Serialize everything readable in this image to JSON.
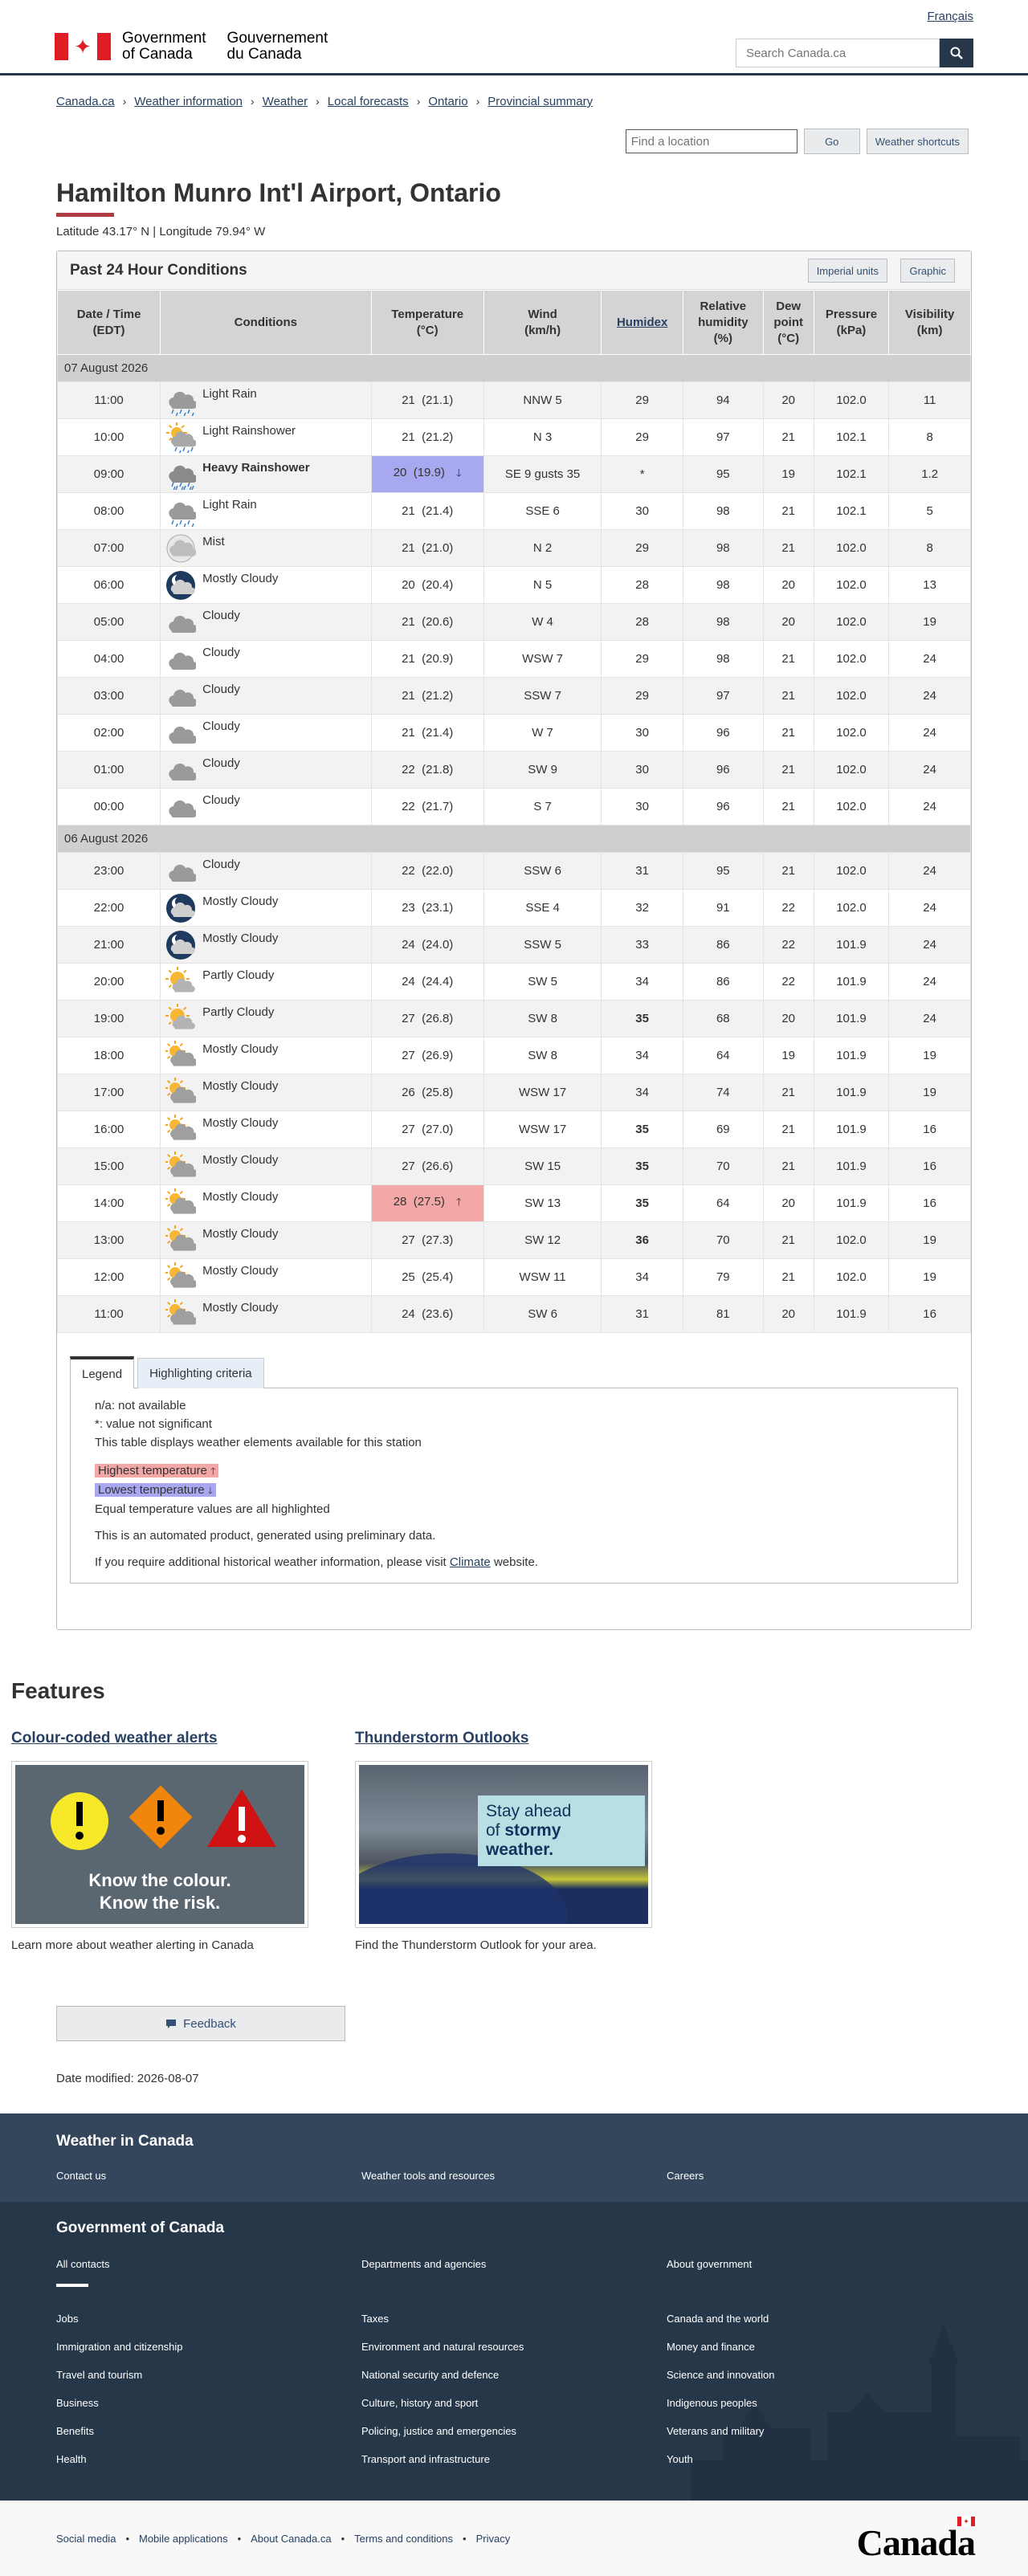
{
  "header": {
    "lang_link": "Français",
    "sig_en": [
      "Government",
      "of Canada"
    ],
    "sig_fr": [
      "Gouvernement",
      "du Canada"
    ],
    "search_placeholder": "Search Canada.ca"
  },
  "breadcrumb": [
    "Canada.ca",
    "Weather information",
    "Weather",
    "Local forecasts",
    "Ontario",
    "Provincial summary"
  ],
  "location_search": {
    "placeholder": "Find a location",
    "go_label": "Go",
    "shortcuts_label": "Weather shortcuts"
  },
  "page": {
    "title": "Hamilton Munro Int'l Airport, Ontario",
    "latlon": "Latitude 43.17° N | Longitude 79.94° W"
  },
  "panel": {
    "title": "Past 24 Hour Conditions",
    "imperial_label": "Imperial units",
    "graphic_label": "Graphic"
  },
  "table": {
    "headers": {
      "datetime": [
        "Date / Time",
        "(EDT)"
      ],
      "conditions": "Conditions",
      "temperature": [
        "Temperature",
        "(°C)"
      ],
      "wind": [
        "Wind",
        "(km/h)"
      ],
      "humidex": "Humidex",
      "humidity": [
        "Relative",
        "humidity",
        "(%)"
      ],
      "dewpoint": [
        "Dew",
        "point",
        "(°C)"
      ],
      "pressure": [
        "Pressure",
        "(kPa)"
      ],
      "visibility": [
        "Visibility",
        "(km)"
      ]
    },
    "groups": [
      {
        "date": "07 August 2026",
        "rows": [
          {
            "time": "11:00",
            "icon": "rain-icon",
            "cond": "Light Rain",
            "temp": "21",
            "temp_exact": "(21.1)",
            "wind": "NNW 5",
            "humidex": "29",
            "hum": "94",
            "dew": "20",
            "pres": "102.0",
            "vis": "11"
          },
          {
            "time": "10:00",
            "icon": "sun-rain-icon",
            "cond": "Light Rainshower",
            "temp": "21",
            "temp_exact": "(21.2)",
            "wind": "N 3",
            "humidex": "29",
            "hum": "97",
            "dew": "21",
            "pres": "102.1",
            "vis": "8"
          },
          {
            "time": "09:00",
            "icon": "heavy-rain-icon",
            "cond": "Heavy Rainshower",
            "cond_bold": true,
            "temp": "20",
            "temp_exact": "(19.9)",
            "temp_flag": "low",
            "wind": "SE 9 gusts 35",
            "humidex": "*",
            "hum": "95",
            "dew": "19",
            "pres": "102.1",
            "vis": "1.2"
          },
          {
            "time": "08:00",
            "icon": "rain-icon",
            "cond": "Light Rain",
            "temp": "21",
            "temp_exact": "(21.4)",
            "wind": "SSE 6",
            "humidex": "30",
            "hum": "98",
            "dew": "21",
            "pres": "102.1",
            "vis": "5"
          },
          {
            "time": "07:00",
            "icon": "mist-icon",
            "cond": "Mist",
            "temp": "21",
            "temp_exact": "(21.0)",
            "wind": "N 2",
            "humidex": "29",
            "hum": "98",
            "dew": "21",
            "pres": "102.0",
            "vis": "8"
          },
          {
            "time": "06:00",
            "icon": "night-cloud-icon",
            "cond": "Mostly Cloudy",
            "temp": "20",
            "temp_exact": "(20.4)",
            "wind": "N 5",
            "humidex": "28",
            "hum": "98",
            "dew": "20",
            "pres": "102.0",
            "vis": "13"
          },
          {
            "time": "05:00",
            "icon": "cloud-icon",
            "cond": "Cloudy",
            "temp": "21",
            "temp_exact": "(20.6)",
            "wind": "W 4",
            "humidex": "28",
            "hum": "98",
            "dew": "20",
            "pres": "102.0",
            "vis": "19"
          },
          {
            "time": "04:00",
            "icon": "cloud-icon",
            "cond": "Cloudy",
            "temp": "21",
            "temp_exact": "(20.9)",
            "wind": "WSW 7",
            "humidex": "29",
            "hum": "98",
            "dew": "21",
            "pres": "102.0",
            "vis": "24"
          },
          {
            "time": "03:00",
            "icon": "cloud-icon",
            "cond": "Cloudy",
            "temp": "21",
            "temp_exact": "(21.2)",
            "wind": "SSW 7",
            "humidex": "29",
            "hum": "97",
            "dew": "21",
            "pres": "102.0",
            "vis": "24"
          },
          {
            "time": "02:00",
            "icon": "cloud-icon",
            "cond": "Cloudy",
            "temp": "21",
            "temp_exact": "(21.4)",
            "wind": "W 7",
            "humidex": "30",
            "hum": "96",
            "dew": "21",
            "pres": "102.0",
            "vis": "24"
          },
          {
            "time": "01:00",
            "icon": "cloud-icon",
            "cond": "Cloudy",
            "temp": "22",
            "temp_exact": "(21.8)",
            "wind": "SW 9",
            "humidex": "30",
            "hum": "96",
            "dew": "21",
            "pres": "102.0",
            "vis": "24"
          },
          {
            "time": "00:00",
            "icon": "cloud-icon",
            "cond": "Cloudy",
            "temp": "22",
            "temp_exact": "(21.7)",
            "wind": "S 7",
            "humidex": "30",
            "hum": "96",
            "dew": "21",
            "pres": "102.0",
            "vis": "24"
          }
        ]
      },
      {
        "date": "06 August 2026",
        "rows": [
          {
            "time": "23:00",
            "icon": "cloud-icon",
            "cond": "Cloudy",
            "temp": "22",
            "temp_exact": "(22.0)",
            "wind": "SSW 6",
            "humidex": "31",
            "hum": "95",
            "dew": "21",
            "pres": "102.0",
            "vis": "24"
          },
          {
            "time": "22:00",
            "icon": "night-cloud-icon",
            "cond": "Mostly Cloudy",
            "temp": "23",
            "temp_exact": "(23.1)",
            "wind": "SSE 4",
            "humidex": "32",
            "hum": "91",
            "dew": "22",
            "pres": "102.0",
            "vis": "24"
          },
          {
            "time": "21:00",
            "icon": "night-cloud-icon",
            "cond": "Mostly Cloudy",
            "temp": "24",
            "temp_exact": "(24.0)",
            "wind": "SSW 5",
            "humidex": "33",
            "hum": "86",
            "dew": "22",
            "pres": "101.9",
            "vis": "24"
          },
          {
            "time": "20:00",
            "icon": "sun-cloud-icon",
            "cond": "Partly Cloudy",
            "temp": "24",
            "temp_exact": "(24.4)",
            "wind": "SW 5",
            "humidex": "34",
            "hum": "86",
            "dew": "22",
            "pres": "101.9",
            "vis": "24"
          },
          {
            "time": "19:00",
            "icon": "sun-cloud-icon",
            "cond": "Partly Cloudy",
            "temp": "27",
            "temp_exact": "(26.8)",
            "wind": "SW 8",
            "humidex": "35",
            "humidex_bold": true,
            "hum": "68",
            "dew": "20",
            "pres": "101.9",
            "vis": "24"
          },
          {
            "time": "18:00",
            "icon": "mostly-cloudy-day-icon",
            "cond": "Mostly Cloudy",
            "temp": "27",
            "temp_exact": "(26.9)",
            "wind": "SW 8",
            "humidex": "34",
            "hum": "64",
            "dew": "19",
            "pres": "101.9",
            "vis": "19"
          },
          {
            "time": "17:00",
            "icon": "mostly-cloudy-day-icon",
            "cond": "Mostly Cloudy",
            "temp": "26",
            "temp_exact": "(25.8)",
            "wind": "WSW 17",
            "humidex": "34",
            "hum": "74",
            "dew": "21",
            "pres": "101.9",
            "vis": "19"
          },
          {
            "time": "16:00",
            "icon": "mostly-cloudy-day-icon",
            "cond": "Mostly Cloudy",
            "temp": "27",
            "temp_exact": "(27.0)",
            "wind": "WSW 17",
            "humidex": "35",
            "humidex_bold": true,
            "hum": "69",
            "dew": "21",
            "pres": "101.9",
            "vis": "16"
          },
          {
            "time": "15:00",
            "icon": "mostly-cloudy-day-icon",
            "cond": "Mostly Cloudy",
            "temp": "27",
            "temp_exact": "(26.6)",
            "wind": "SW 15",
            "humidex": "35",
            "humidex_bold": true,
            "hum": "70",
            "dew": "21",
            "pres": "101.9",
            "vis": "16"
          },
          {
            "time": "14:00",
            "icon": "mostly-cloudy-day-icon",
            "cond": "Mostly Cloudy",
            "temp": "28",
            "temp_exact": "(27.5)",
            "temp_flag": "high",
            "wind": "SW 13",
            "humidex": "35",
            "humidex_bold": true,
            "hum": "64",
            "dew": "20",
            "pres": "101.9",
            "vis": "16"
          },
          {
            "time": "13:00",
            "icon": "mostly-cloudy-day-icon",
            "cond": "Mostly Cloudy",
            "temp": "27",
            "temp_exact": "(27.3)",
            "wind": "SW 12",
            "humidex": "36",
            "humidex_bold": true,
            "hum": "70",
            "dew": "21",
            "pres": "102.0",
            "vis": "19"
          },
          {
            "time": "12:00",
            "icon": "mostly-cloudy-day-icon",
            "cond": "Mostly Cloudy",
            "temp": "25",
            "temp_exact": "(25.4)",
            "wind": "WSW 11",
            "humidex": "34",
            "hum": "79",
            "dew": "21",
            "pres": "102.0",
            "vis": "19"
          },
          {
            "time": "11:00",
            "icon": "mostly-cloudy-day-icon",
            "cond": "Mostly Cloudy",
            "temp": "24",
            "temp_exact": "(23.6)",
            "wind": "SW 6",
            "humidex": "31",
            "hum": "81",
            "dew": "20",
            "pres": "101.9",
            "vis": "16"
          }
        ]
      }
    ]
  },
  "legend": {
    "tab_legend": "Legend",
    "tab_highlight": "Highlighting criteria",
    "na": "n/a: not available",
    "star": "*: value not significant",
    "elements": "This table displays weather elements available for this station",
    "highest": "Highest temperature",
    "lowest": "Lowest temperature",
    "equal": "Equal temperature values are all highlighted",
    "automated": "This is an automated product, generated using preliminary data.",
    "historical_pre": "If you require additional historical weather information, please visit",
    "historical_link": "Climate",
    "historical_post": "website."
  },
  "features": {
    "title": "Features",
    "cards": [
      {
        "link": "Colour-coded weather alerts",
        "image_text": [
          "Know the colour.",
          "Know the risk."
        ],
        "desc": "Learn more about weather alerting in Canada"
      },
      {
        "link": "Thunderstorm Outlooks",
        "image_text": [
          "Stay ahead",
          "of",
          "stormy",
          "weather."
        ],
        "desc": "Find the Thunderstorm Outlook for your area."
      }
    ]
  },
  "feedback_label": "Feedback",
  "date_modified": "Date modified: 2026-08-07",
  "footer": {
    "weather_heading": "Weather in Canada",
    "weather_links": [
      "Contact us",
      "Weather tools and resources",
      "Careers"
    ],
    "gc_heading": "Government of Canada",
    "gc_top_links": [
      "All contacts",
      "Departments and agencies",
      "About government"
    ],
    "gc_links_col1": [
      "Jobs",
      "Immigration and citizenship",
      "Travel and tourism",
      "Business",
      "Benefits",
      "Health"
    ],
    "gc_links_col2": [
      "Taxes",
      "Environment and natural resources",
      "National security and defence",
      "Culture, history and sport",
      "Policing, justice and emergencies",
      "Transport and infrastructure"
    ],
    "gc_links_col3": [
      "Canada and the world",
      "Money and finance",
      "Science and innovation",
      "Indigenous peoples",
      "Veterans and military",
      "Youth"
    ],
    "bottom_links": [
      "Social media",
      "Mobile applications",
      "About Canada.ca",
      "Terms and conditions",
      "Privacy"
    ],
    "wordmark": "Canada"
  },
  "colors": {
    "gc_blue": "#26374a",
    "accent_red": "#af3c43",
    "high_temp": "#f3a7a7",
    "low_temp": "#a8a8f0"
  }
}
